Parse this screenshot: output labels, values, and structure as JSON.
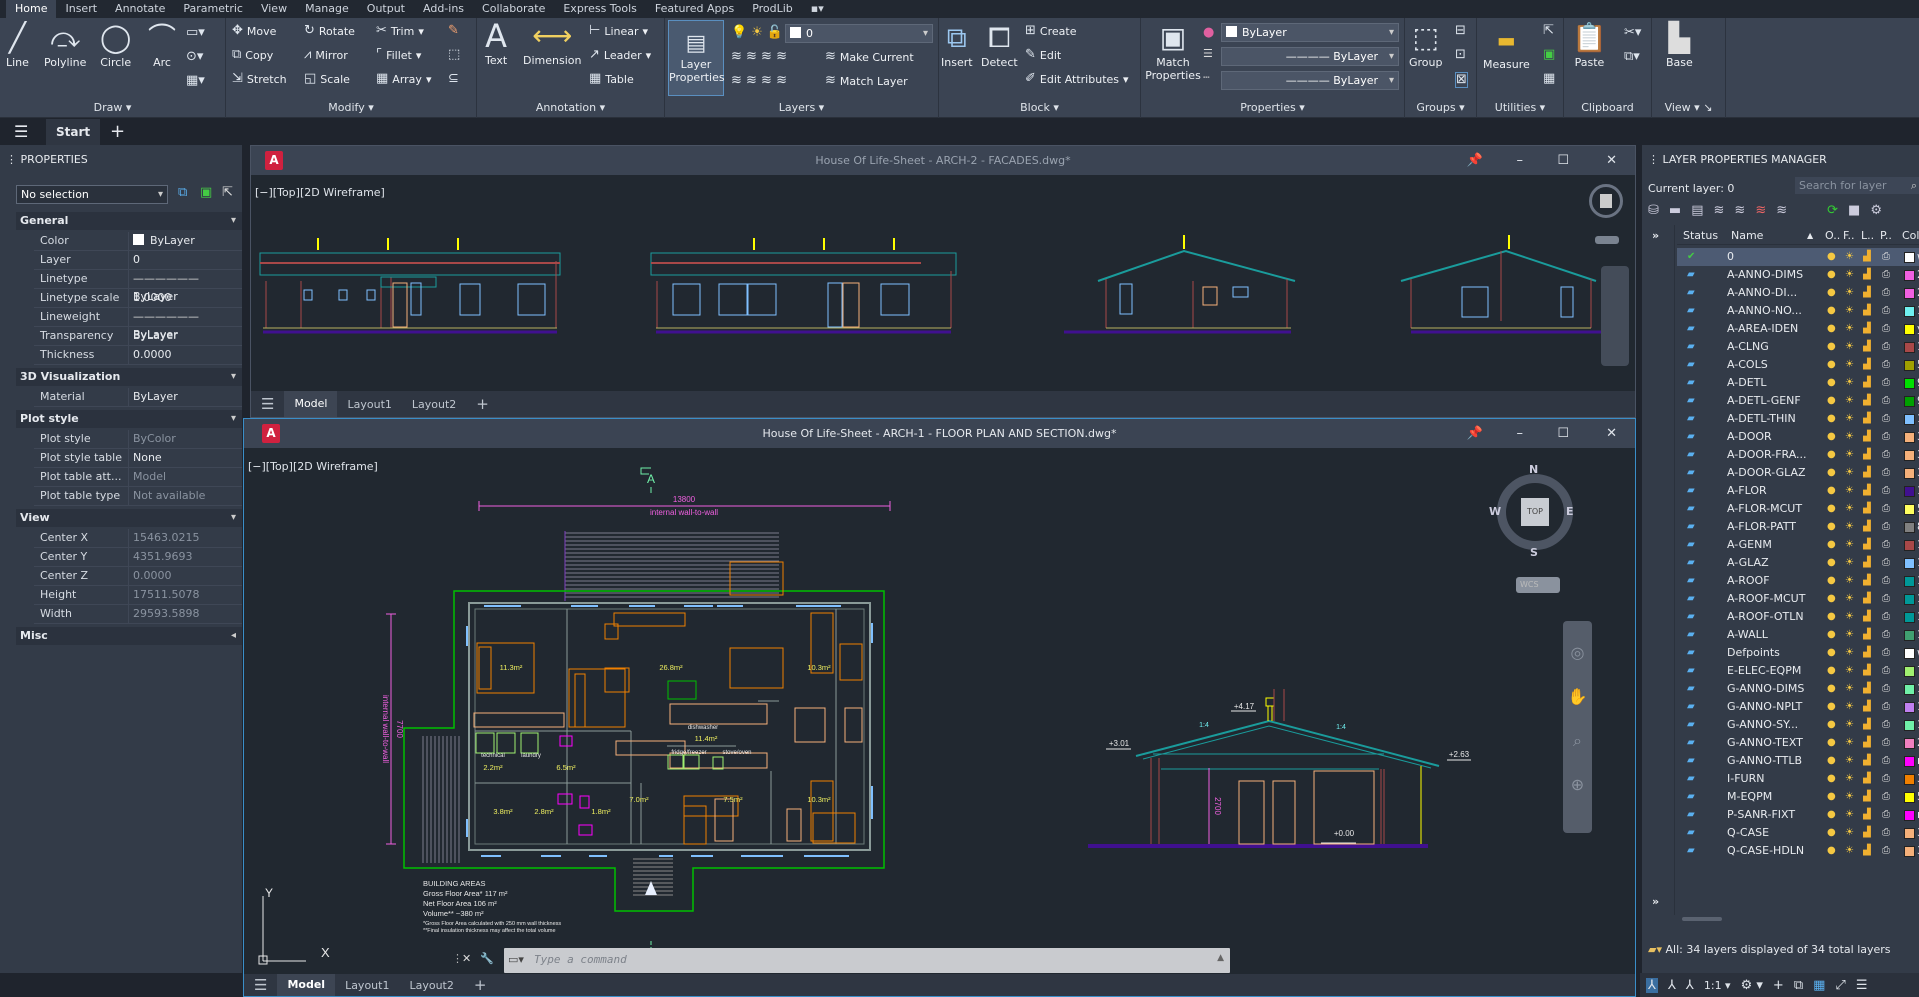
{
  "menu_tabs": [
    "Home",
    "Insert",
    "Annotate",
    "Parametric",
    "View",
    "Manage",
    "Output",
    "Add-ins",
    "Collaborate",
    "Express Tools",
    "Featured Apps",
    "ProdLib"
  ],
  "ribbon": {
    "draw": {
      "title": "Draw",
      "line": "Line",
      "polyline": "Polyline",
      "circle": "Circle",
      "arc": "Arc"
    },
    "modify": {
      "title": "Modify",
      "move": "Move",
      "rotate": "Rotate",
      "trim": "Trim",
      "copy": "Copy",
      "mirror": "Mirror",
      "fillet": "Fillet",
      "stretch": "Stretch",
      "scale": "Scale",
      "array": "Array"
    },
    "annotation": {
      "title": "Annotation",
      "text": "Text",
      "dimension": "Dimension",
      "linear": "Linear",
      "leader": "Leader",
      "table": "Table"
    },
    "layers": {
      "title": "Layers",
      "layer_properties": "Layer Properties",
      "current_layer": "0",
      "make_current": "Make Current",
      "match_layer": "Match Layer"
    },
    "block": {
      "title": "Block",
      "insert": "Insert",
      "detect": "Detect",
      "create": "Create",
      "edit": "Edit",
      "edit_attributes": "Edit Attributes"
    },
    "properties": {
      "title": "Properties",
      "match_properties": "Match Properties",
      "color": "ByLayer",
      "linetype": "ByLayer",
      "lineweight": "ByLayer"
    },
    "groups": {
      "title": "Groups",
      "group": "Group"
    },
    "utilities": {
      "title": "Utilities",
      "measure": "Measure"
    },
    "clipboard": {
      "title": "Clipboard",
      "paste": "Paste"
    },
    "view": {
      "title": "View",
      "base": "Base"
    }
  },
  "file_tabs": {
    "start": "Start"
  },
  "properties_panel": {
    "title": "PROPERTIES",
    "selection": "No selection",
    "sections": [
      {
        "name": "General",
        "rows": [
          [
            "Color",
            "ByLayer"
          ],
          [
            "Layer",
            "0"
          ],
          [
            "Linetype",
            "ByLayer"
          ],
          [
            "Linetype scale",
            "1.0000"
          ],
          [
            "Lineweight",
            "ByLayer"
          ],
          [
            "Transparency",
            "ByLayer"
          ],
          [
            "Thickness",
            "0.0000"
          ]
        ]
      },
      {
        "name": "3D Visualization",
        "rows": [
          [
            "Material",
            "ByLayer"
          ]
        ]
      },
      {
        "name": "Plot style",
        "rows": [
          [
            "Plot style",
            "ByColor"
          ],
          [
            "Plot style table",
            "None"
          ],
          [
            "Plot table att...",
            "Model"
          ],
          [
            "Plot table type",
            "Not available"
          ]
        ]
      },
      {
        "name": "View",
        "rows": [
          [
            "Center X",
            "15463.0215"
          ],
          [
            "Center Y",
            "4351.9693"
          ],
          [
            "Center Z",
            "0.0000"
          ],
          [
            "Height",
            "17511.5078"
          ],
          [
            "Width",
            "29593.5898"
          ]
        ]
      },
      {
        "name": "Misc",
        "rows": []
      }
    ]
  },
  "facades_window": {
    "title": "House Of Life-Sheet - ARCH-2 - FACADES.dwg*",
    "viewport_label": "[−][Top][2D Wireframe]",
    "tabs": [
      "Model",
      "Layout1",
      "Layout2"
    ]
  },
  "floorplan_window": {
    "title": "House Of Life-Sheet - ARCH-1 - FLOOR PLAN AND SECTION.dwg*",
    "viewport_label": "[−][Top][2D Wireframe]",
    "tabs": [
      "Model",
      "Layout1",
      "Layout2"
    ],
    "viewcube": {
      "n": "N",
      "s": "S",
      "e": "E",
      "w": "W",
      "face": "TOP",
      "ucs": "WCS"
    },
    "command_placeholder": "Type a command",
    "drawing": {
      "section_marker": "A",
      "overall_dim": "13800",
      "overall_dim_note": "internal wall-to-wall",
      "side_dim": "7700",
      "side_dim_note": "internal wall-to-wall",
      "rooms": [
        "11.3m²",
        "26.8m²",
        "10.3m²",
        "11.4m²",
        "2.2m²",
        "6.5m²",
        "7.0m²",
        "7.5m²",
        "10.3m²",
        "3.8m²",
        "2.8m²",
        "1.8m²"
      ],
      "labels": {
        "dishwasher": "dishwasher",
        "fridge": "fridge/freezer",
        "stove": "stove/oven",
        "technical": "technical",
        "laundry": "laundry"
      },
      "areas": {
        "heading": "BUILDING AREAS",
        "gross": "Gross Floor Area*  117 m²",
        "net": "Net Floor Area      106 m²",
        "volume": "Volume**             ~380 m²",
        "note1": "*Gross Floor Area calculated with 250 mm wall thickness",
        "note2": "**Final insulation thickness may affect the total volume"
      },
      "section": {
        "ridge": "+4.17",
        "left_eave": "+3.01",
        "right_eave": "+2.63",
        "floor": "+0.00",
        "height": "2700",
        "slope_left": "1:4",
        "slope_right": "1:4"
      }
    }
  },
  "layer_manager": {
    "title": "LAYER PROPERTIES MANAGER",
    "current_layer": "Current layer: 0",
    "search_placeholder": "Search for layer",
    "columns": [
      "Status",
      "Name",
      "O..",
      "F..",
      "L..",
      "P..",
      "Color"
    ],
    "footer": "All: 34 layers displayed of 34 total layers",
    "layers": [
      {
        "name": "0",
        "color": "#ffffff",
        "cv": "w",
        "current": true
      },
      {
        "name": "A-ANNO-DIMS",
        "color": "#f060e0",
        "cv": "2"
      },
      {
        "name": "A-ANNO-DI...",
        "color": "#f060e0",
        "cv": "2"
      },
      {
        "name": "A-ANNO-NO...",
        "color": "#70f0f0",
        "cv": "1"
      },
      {
        "name": "A-AREA-IDEN",
        "color": "#ffff00",
        "cv": "ye"
      },
      {
        "name": "A-CLNG",
        "color": "#a84848",
        "cv": "1"
      },
      {
        "name": "A-COLS",
        "color": "#a0a000",
        "cv": "5"
      },
      {
        "name": "A-DETL",
        "color": "#00e000",
        "cv": "9"
      },
      {
        "name": "A-DETL-GENF",
        "color": "#00a000",
        "cv": "9"
      },
      {
        "name": "A-DETL-THIN",
        "color": "#80c0ff",
        "cv": "1"
      },
      {
        "name": "A-DOOR",
        "color": "#f5b07a",
        "cv": "3"
      },
      {
        "name": "A-DOOR-FRA...",
        "color": "#f5b07a",
        "cv": "3"
      },
      {
        "name": "A-DOOR-GLAZ",
        "color": "#f5b07a",
        "cv": "3"
      },
      {
        "name": "A-FLOR",
        "color": "#40108f",
        "cv": "1"
      },
      {
        "name": "A-FLOR-MCUT",
        "color": "#ffff60",
        "cv": "5"
      },
      {
        "name": "A-FLOR-PATT",
        "color": "#808080",
        "cv": "8"
      },
      {
        "name": "A-GENM",
        "color": "#a84848",
        "cv": "1"
      },
      {
        "name": "A-GLAZ",
        "color": "#80c0ff",
        "cv": "1"
      },
      {
        "name": "A-ROOF",
        "color": "#009898",
        "cv": "1"
      },
      {
        "name": "A-ROOF-MCUT",
        "color": "#009898",
        "cv": "1"
      },
      {
        "name": "A-ROOF-OTLN",
        "color": "#009898",
        "cv": "1"
      },
      {
        "name": "A-WALL",
        "color": "#40a070",
        "cv": "1"
      },
      {
        "name": "Defpoints",
        "color": "#ffffff",
        "cv": "w"
      },
      {
        "name": "E-ELEC-EQPM",
        "color": "#a0f070",
        "cv": "7"
      },
      {
        "name": "G-ANNO-DIMS",
        "color": "#70f0a8",
        "cv": "1"
      },
      {
        "name": "G-ANNO-NPLT",
        "color": "#c080f0",
        "cv": "1"
      },
      {
        "name": "G-ANNO-SY...",
        "color": "#70f0a8",
        "cv": "1"
      },
      {
        "name": "G-ANNO-TEXT",
        "color": "#f080c0",
        "cv": "2"
      },
      {
        "name": "G-ANNO-TTLB",
        "color": "#ff00ff",
        "cv": "m"
      },
      {
        "name": "I-FURN",
        "color": "#f08000",
        "cv": "3"
      },
      {
        "name": "M-EQPM",
        "color": "#ffff00",
        "cv": "5"
      },
      {
        "name": "P-SANR-FIXT",
        "color": "#ff00ff",
        "cv": "m"
      },
      {
        "name": "Q-CASE",
        "color": "#f5b07a",
        "cv": "3"
      },
      {
        "name": "Q-CASE-HDLN",
        "color": "#f5b07a",
        "cv": "3"
      }
    ]
  },
  "status_bar": {
    "scale": "1:1"
  }
}
